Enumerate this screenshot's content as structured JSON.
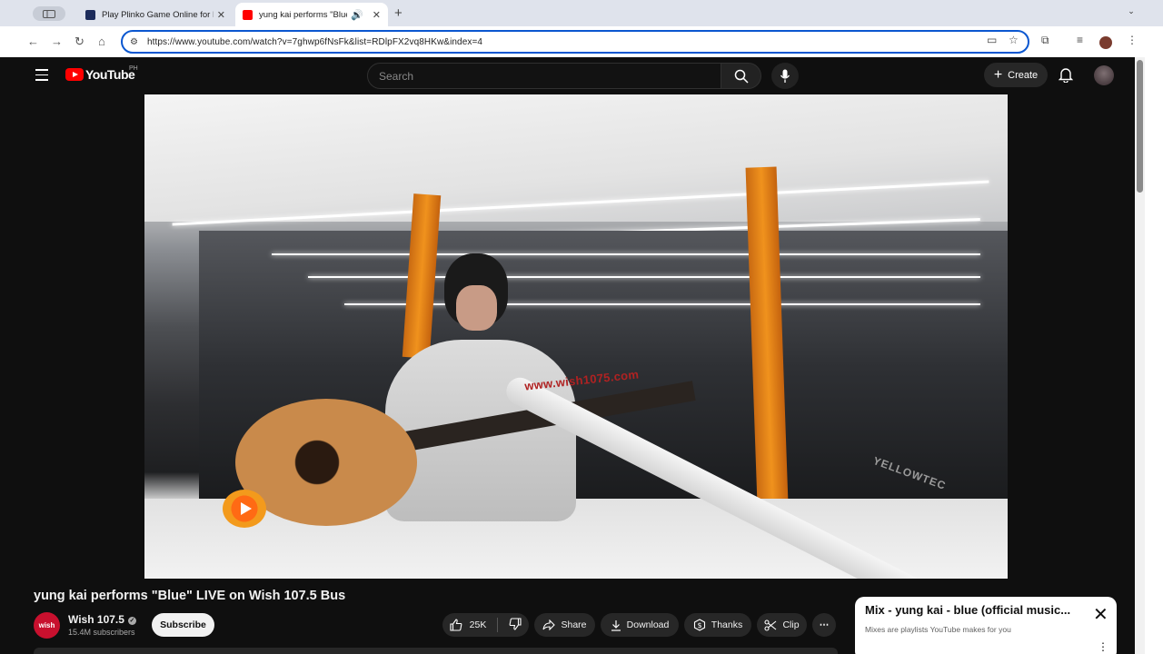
{
  "browser": {
    "tabs": [
      {
        "title": "Play Plinko Game Online for F",
        "favicon_color": "#1c2b5a"
      },
      {
        "title": "yung kai performs \"Blue\"",
        "favicon_color": "#ff0000"
      }
    ],
    "url": "https://www.youtube.com/watch?v=7ghwp6fNsFk&list=RDlpFX2vq8HKw&index=4"
  },
  "header": {
    "logo_text": "YouTube",
    "country_code": "PH",
    "search_placeholder": "Search",
    "create_label": "Create"
  },
  "video": {
    "boom_text": "www.wish1075.com",
    "yellowtec_text": "YELLOWTEC"
  },
  "watch": {
    "title": "yung kai performs \"Blue\" LIVE on Wish 107.5 Bus",
    "channel_name": "Wish 107.5",
    "channel_avatar_text": "wish",
    "subscribers": "15.4M subscribers",
    "subscribe_label": "Subscribe",
    "likes": "25K",
    "share_label": "Share",
    "download_label": "Download",
    "thanks_label": "Thanks",
    "clip_label": "Clip"
  },
  "mix": {
    "title": "Mix - yung kai - blue (official music...",
    "subtitle": "Mixes are playlists YouTube makes for you"
  },
  "colors": {
    "yt_red": "#ff0000",
    "page_bg": "#0f0f0f",
    "omnibox_focus": "#0b57d0"
  }
}
